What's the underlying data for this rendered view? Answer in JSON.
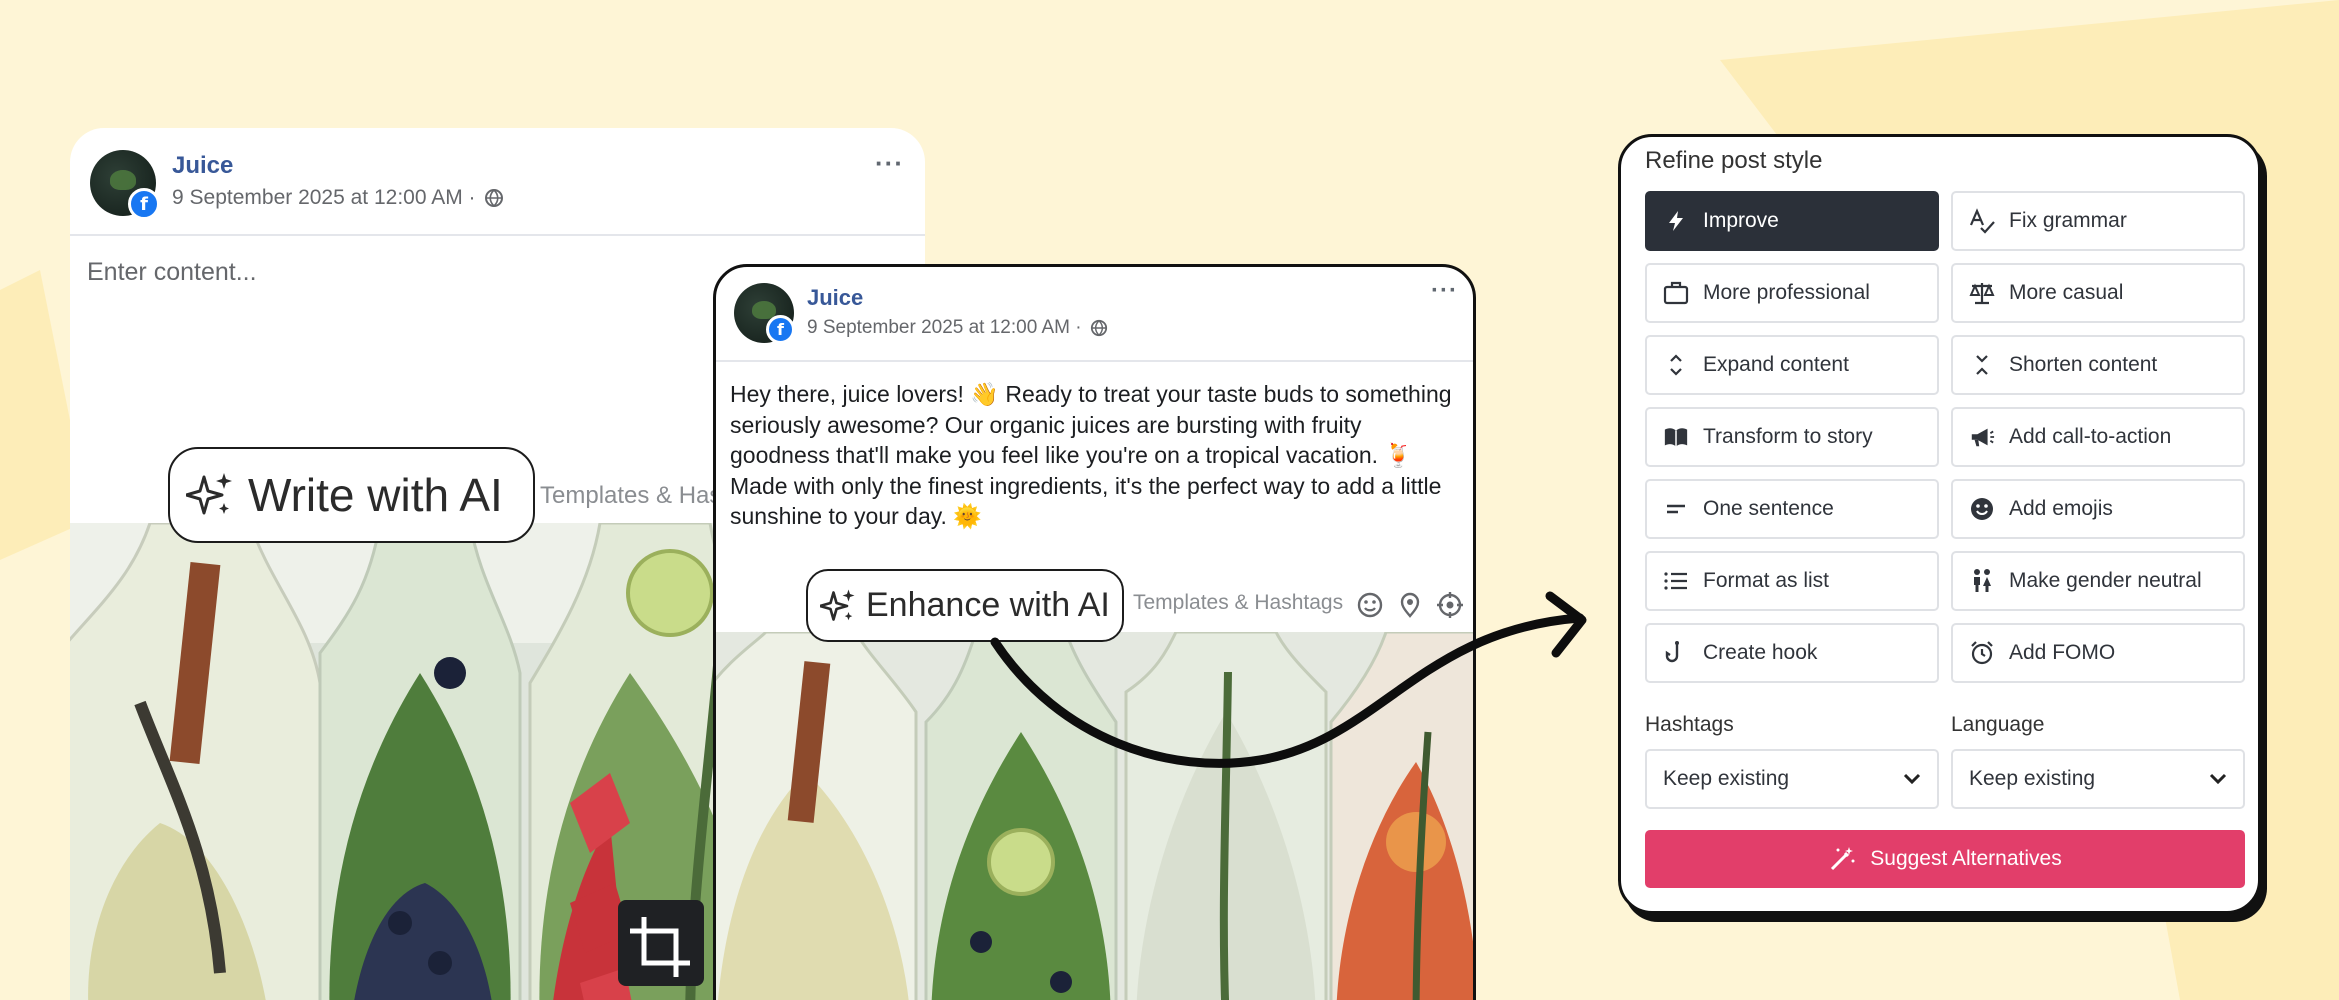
{
  "colors": {
    "background": "#fef5d6",
    "accent_shape": "#fdedb8",
    "page_name": "#385898",
    "facebook_blue": "#1877f2",
    "active_option": "#2b3039",
    "suggest_button": "#e23e6a"
  },
  "post_editor": {
    "page_name": "Juice",
    "timestamp": "9 September 2025 at 12:00 AM ·",
    "audience_icon": "globe-icon",
    "placeholder": "Enter content...",
    "write_ai_label": "Write with AI",
    "templates_link": "Templates & Hashtags",
    "crop_icon": "crop-icon"
  },
  "post_preview": {
    "page_name": "Juice",
    "timestamp": "9 September 2025 at 12:00 AM ·",
    "body_text": "Hey there, juice lovers! 👋 Ready to treat your taste buds to something seriously awesome? Our organic juices are bursting with fruity goodness that'll make you feel like you're on a tropical vacation. 🍹 Made with only the finest ingredients, it's the perfect way to add a little sunshine to your day. 🌞",
    "enhance_ai_label": "Enhance with AI",
    "templates_link": "Templates & Hashtags",
    "toolbar_icons": [
      "emoji-icon",
      "location-pin-icon",
      "target-icon"
    ]
  },
  "refine_panel": {
    "title": "Refine post style",
    "options": [
      {
        "label": "Improve",
        "icon": "lightning-icon",
        "active": true
      },
      {
        "label": "Fix grammar",
        "icon": "spellcheck-icon",
        "active": false
      },
      {
        "label": "More professional",
        "icon": "briefcase-icon",
        "active": false
      },
      {
        "label": "More casual",
        "icon": "scales-icon",
        "active": false
      },
      {
        "label": "Expand content",
        "icon": "expand-icon",
        "active": false
      },
      {
        "label": "Shorten content",
        "icon": "collapse-icon",
        "active": false
      },
      {
        "label": "Transform to story",
        "icon": "book-icon",
        "active": false
      },
      {
        "label": "Add call-to-action",
        "icon": "megaphone-icon",
        "active": false
      },
      {
        "label": "One sentence",
        "icon": "short-lines-icon",
        "active": false
      },
      {
        "label": "Add emojis",
        "icon": "smiley-icon",
        "active": false
      },
      {
        "label": "Format as list",
        "icon": "list-icon",
        "active": false
      },
      {
        "label": "Make gender neutral",
        "icon": "people-icon",
        "active": false
      },
      {
        "label": "Create hook",
        "icon": "hook-icon",
        "active": false
      },
      {
        "label": "Add FOMO",
        "icon": "alarm-clock-icon",
        "active": false
      }
    ],
    "hashtags_label": "Hashtags",
    "hashtags_value": "Keep existing",
    "language_label": "Language",
    "language_value": "Keep existing",
    "suggest_label": "Suggest Alternatives"
  }
}
